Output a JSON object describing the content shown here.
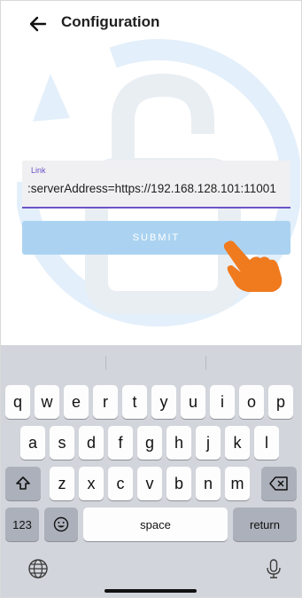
{
  "header": {
    "title": "Configuration",
    "back_icon": "arrow-left-icon"
  },
  "form": {
    "link_label": "Link",
    "link_value": ":serverAddress=https://192.168.128.101:11001"
  },
  "submit_label": "SUBMIT",
  "colors": {
    "accent": "#6b52c9",
    "submit_bg": "#abd3f1",
    "watermark": "#e3effa",
    "hand": "#f07a1e",
    "keyboard_bg": "#d2d5db"
  },
  "keyboard": {
    "row1": [
      "q",
      "w",
      "e",
      "r",
      "t",
      "y",
      "u",
      "i",
      "o",
      "p"
    ],
    "row2": [
      "a",
      "s",
      "d",
      "f",
      "g",
      "h",
      "j",
      "k",
      "l"
    ],
    "row3": [
      "z",
      "x",
      "c",
      "v",
      "b",
      "n",
      "m"
    ],
    "shift_icon": "shift-icon",
    "delete_icon": "backspace-icon",
    "numbers_label": "123",
    "emoji_icon": "emoji-icon",
    "space_label": "space",
    "return_label": "return",
    "globe_icon": "globe-icon",
    "mic_icon": "microphone-icon"
  }
}
